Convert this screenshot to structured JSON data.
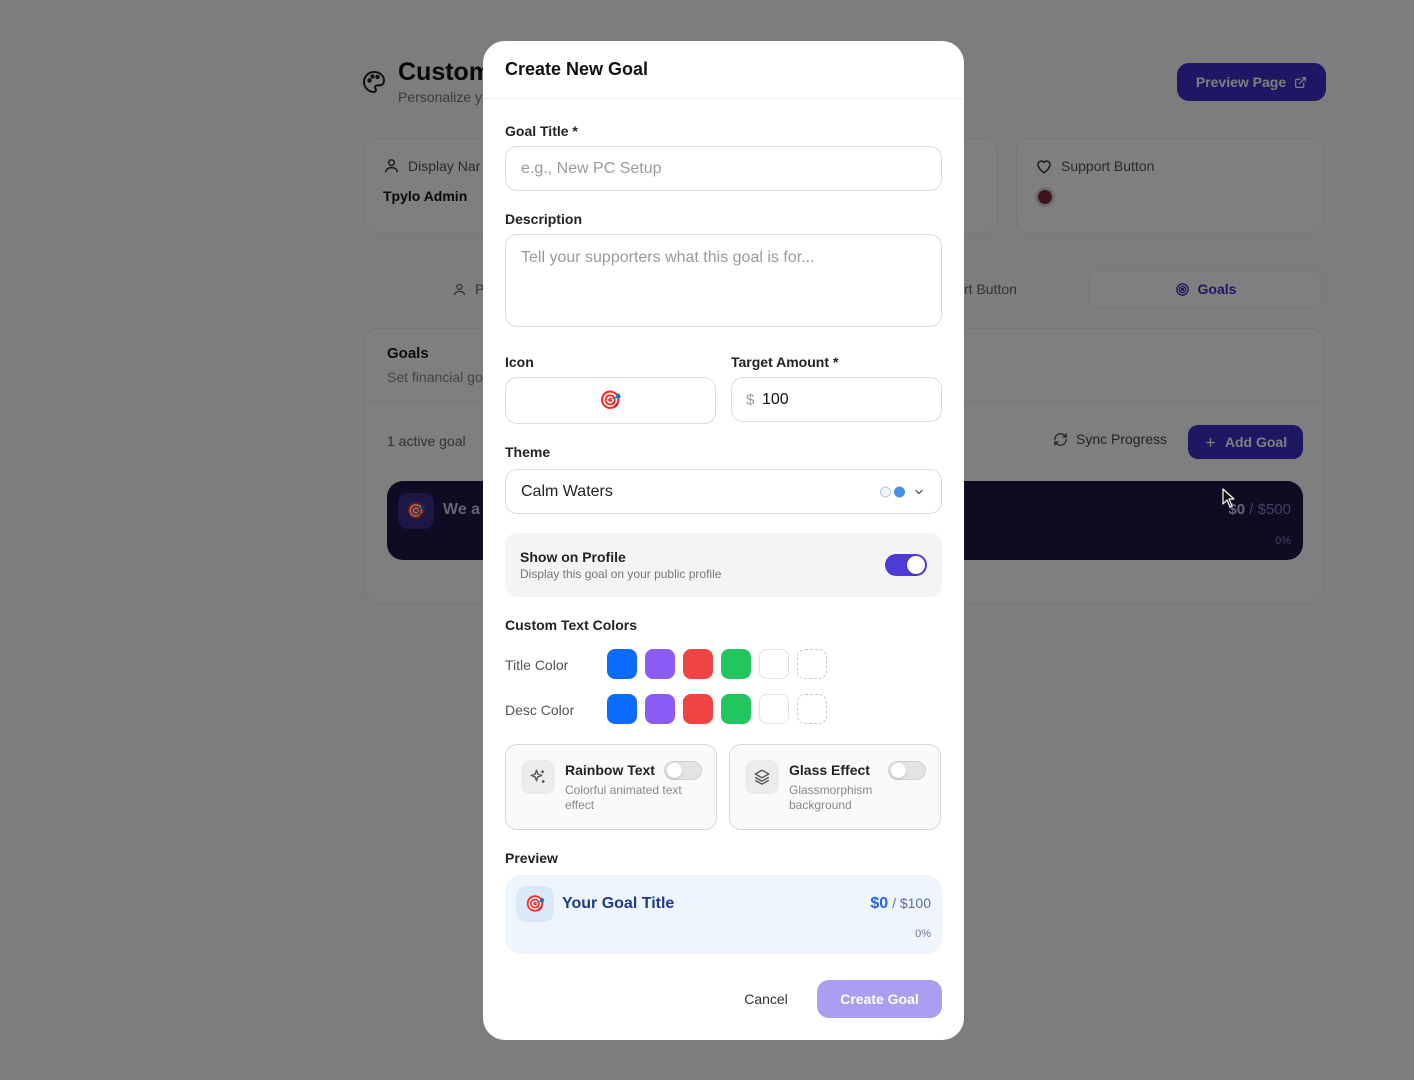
{
  "background": {
    "header": {
      "title": "Custom",
      "subtitle": "Personalize y"
    },
    "preview_button": "Preview Page",
    "cards": {
      "display_name": {
        "label": "Display Nar",
        "value": "Tpylo Admin"
      },
      "support_button": {
        "label": "Support Button"
      }
    },
    "tabs": [
      {
        "label": "P"
      },
      {
        "label": "rt Button"
      },
      {
        "label": "Goals"
      }
    ],
    "goals_panel": {
      "title": "Goals",
      "subtitle": "Set financial go",
      "active_count": "1 active goal",
      "sync_label": "Sync Progress",
      "add_label": "Add Goal",
      "goal": {
        "title": "We a",
        "current": "$0",
        "separator": "/",
        "target": "$500",
        "percent": "0%"
      }
    }
  },
  "modal": {
    "title": "Create New Goal",
    "goal_title": {
      "label": "Goal Title *",
      "placeholder": "e.g., New PC Setup"
    },
    "description": {
      "label": "Description",
      "placeholder": "Tell your supporters what this goal is for..."
    },
    "icon": {
      "label": "Icon",
      "glyph": "🎯"
    },
    "target_amount": {
      "label": "Target Amount *",
      "currency": "$",
      "value": "100"
    },
    "theme": {
      "label": "Theme",
      "value": "Calm Waters",
      "dot_colors": [
        "#eef5fd",
        "#4a90e2"
      ]
    },
    "show_on_profile": {
      "title": "Show on Profile",
      "description": "Display this goal on your public profile",
      "enabled": true
    },
    "custom_text_colors": {
      "heading": "Custom Text Colors",
      "title_color_label": "Title Color",
      "desc_color_label": "Desc Color",
      "swatches": [
        "#0a6cff",
        "#8b5cf6",
        "#ef4444",
        "#22c55e",
        "#ffffff",
        "custom"
      ]
    },
    "effects": [
      {
        "title": "Rainbow Text",
        "description": "Colorful animated text effect",
        "icon": "sparkles-icon",
        "enabled": false
      },
      {
        "title": "Glass Effect",
        "description": "Glassmorphism background",
        "icon": "layers-icon",
        "enabled": false
      }
    ],
    "preview": {
      "heading": "Preview",
      "title": "Your Goal Title",
      "current": "$0",
      "separator": "/",
      "target": "$100",
      "percent": "0%"
    },
    "cancel_label": "Cancel",
    "create_label": "Create Goal"
  },
  "colors": {
    "accent": "#3b2fc9",
    "overlay": "rgba(0,0,0,0.5)",
    "preview_bg": "#eef5fd"
  }
}
